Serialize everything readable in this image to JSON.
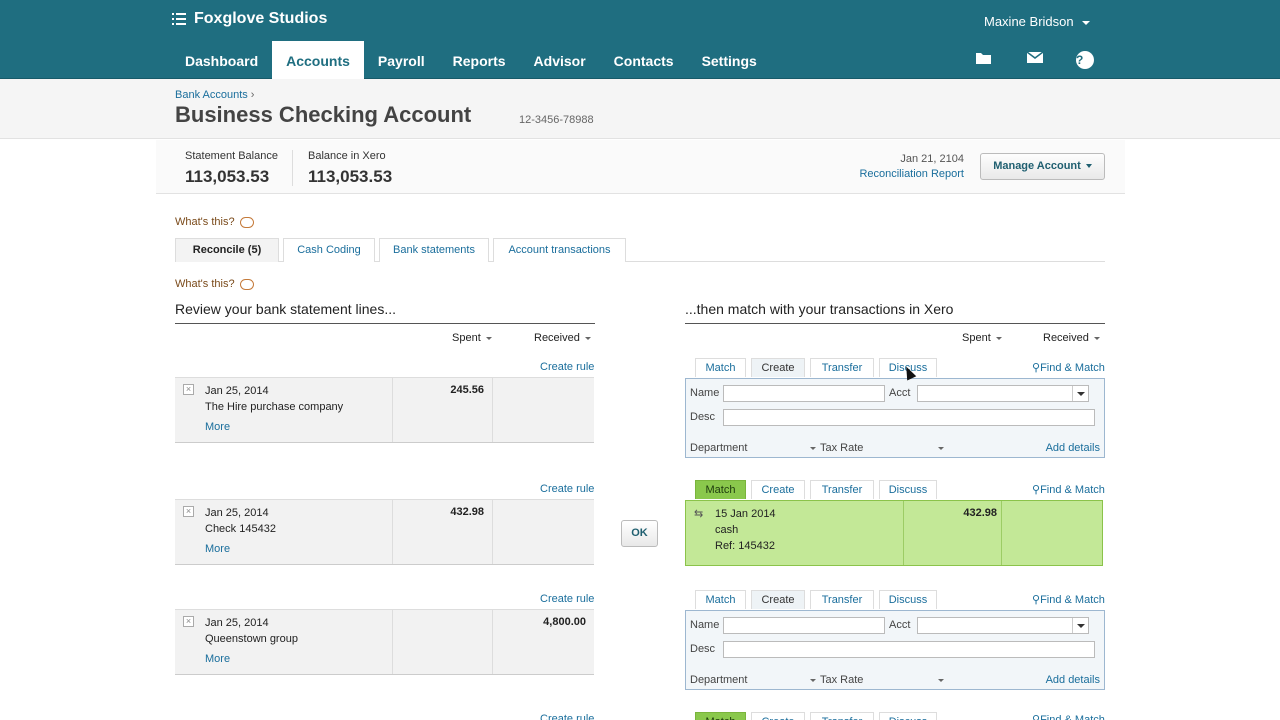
{
  "header": {
    "org_name": "Foxglove Studios",
    "user_name": "Maxine Bridson",
    "nav": [
      "Dashboard",
      "Accounts",
      "Payroll",
      "Reports",
      "Advisor",
      "Contacts",
      "Settings"
    ],
    "active_nav": "Accounts",
    "icons": [
      "folder-icon",
      "mail-icon",
      "help-icon"
    ],
    "help_glyph": "?"
  },
  "page": {
    "breadcrumb": "Bank Accounts",
    "breadcrumb_sep": "›",
    "title": "Business Checking Account",
    "account_number": "12-3456-78988"
  },
  "balances": {
    "statement_label": "Statement Balance",
    "statement_value": "113,053.53",
    "xero_label": "Balance in Xero",
    "xero_value": "113,053.53",
    "date": "Jan 21, 2104",
    "report_link": "Reconciliation Report",
    "manage_button": "Manage Account"
  },
  "whats_this": "What's this?",
  "tabs": [
    "Reconcile (5)",
    "Cash Coding",
    "Bank statements",
    "Account transactions"
  ],
  "left": {
    "heading": "Review your bank statement lines...",
    "spent": "Spent",
    "received": "Received",
    "create_rule": "Create rule",
    "more": "More",
    "rows": [
      {
        "date": "Jan 25, 2014",
        "payee": "The Hire purchase company",
        "spent": "245.56",
        "received": ""
      },
      {
        "date": "Jan 25, 2014",
        "payee": "Check 145432",
        "spent": "432.98",
        "received": ""
      },
      {
        "date": "Jan 25, 2014",
        "payee": "Queenstown group",
        "spent": "",
        "received": "4,800.00"
      }
    ]
  },
  "right": {
    "heading": "...then match with your transactions in Xero",
    "spent": "Spent",
    "received": "Received",
    "tabs": [
      "Match",
      "Create",
      "Transfer",
      "Discuss"
    ],
    "find_match": "Find & Match",
    "form": {
      "name_label": "Name",
      "acct_label": "Acct",
      "desc_label": "Desc",
      "department": "Department",
      "tax_rate": "Tax Rate",
      "add_details": "Add details"
    },
    "match": {
      "date": "15 Jan 2014",
      "payee": "cash",
      "ref": "Ref: 145432",
      "spent": "432.98"
    }
  },
  "ok_button": "OK"
}
